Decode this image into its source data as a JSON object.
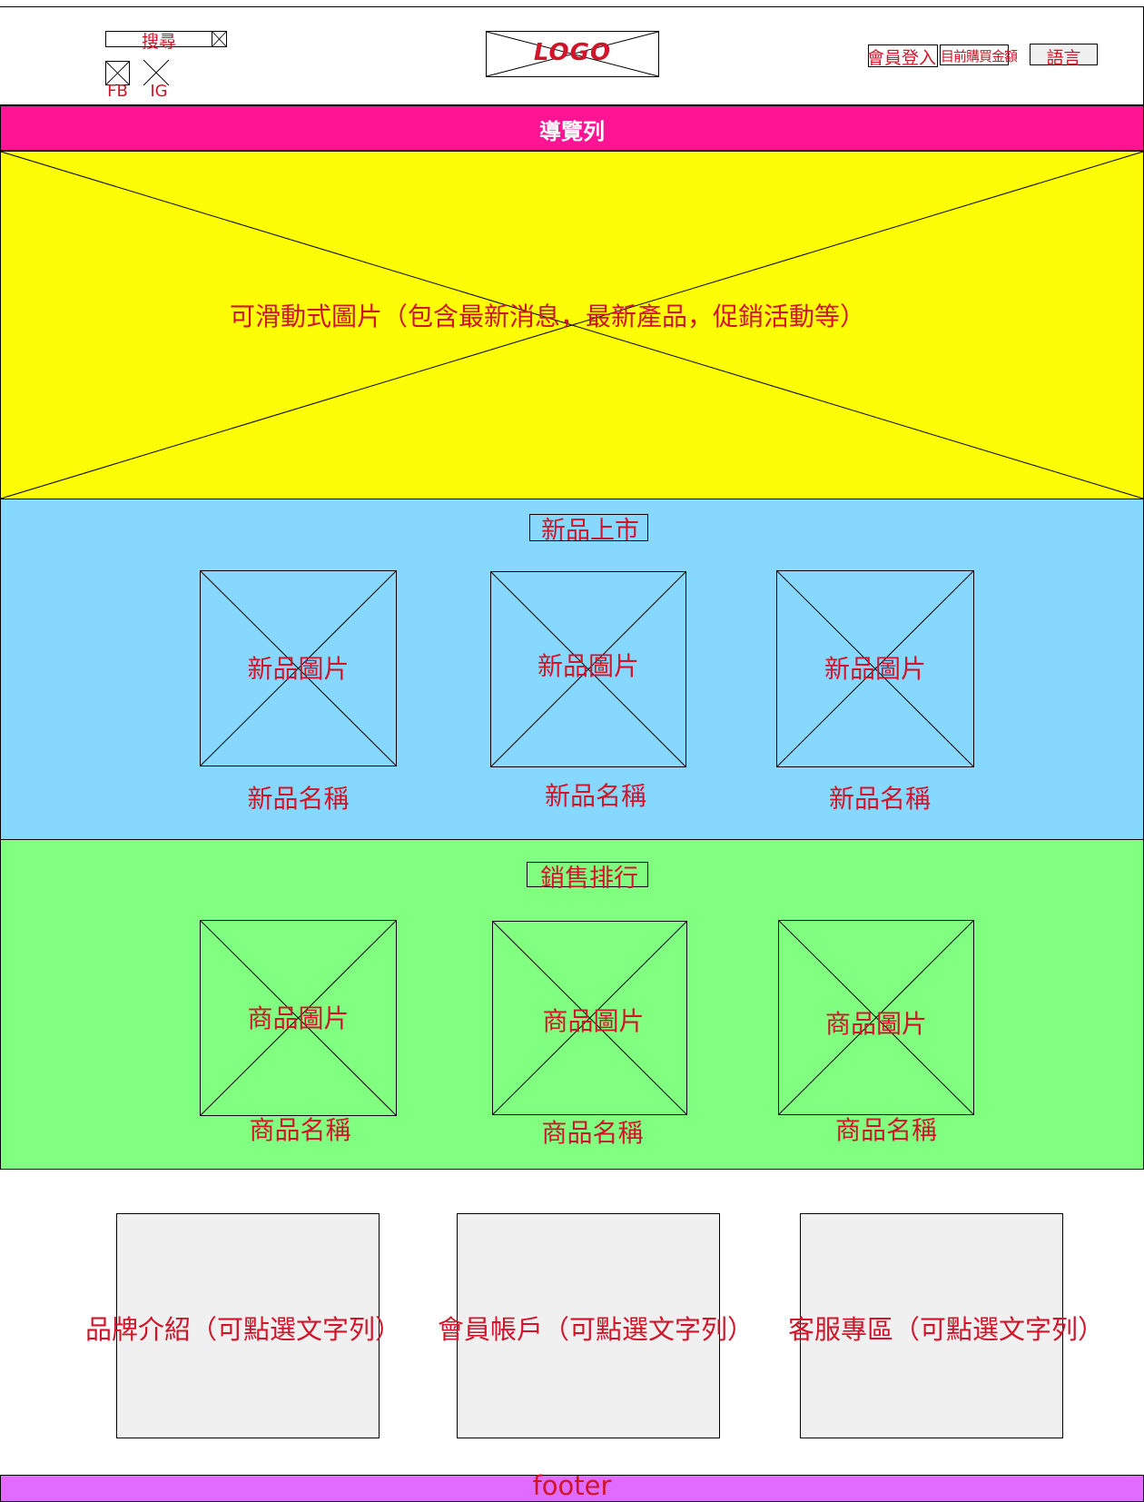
{
  "header": {
    "search_label": "搜尋",
    "fb_label": "FB",
    "ig_label": "IG",
    "logo_text": "LOGO",
    "login_label": "會員登入",
    "cart_label": "目前購買金額",
    "language_label": "語言"
  },
  "nav": {
    "label": "導覽列"
  },
  "hero": {
    "caption": "可滑動式圖片（包含最新消息，最新產品，促銷活動等）"
  },
  "new_products": {
    "title": "新品上市",
    "items": [
      {
        "image_label": "新品圖片",
        "name": "新品名稱"
      },
      {
        "image_label": "新品圖片",
        "name": "新品名稱"
      },
      {
        "image_label": "新品圖片",
        "name": "新品名稱"
      }
    ]
  },
  "best_sellers": {
    "title": "銷售排行",
    "items": [
      {
        "image_label": "商品圖片",
        "name": "商品名稱"
      },
      {
        "image_label": "商品圖片",
        "name": "商品名稱"
      },
      {
        "image_label": "商品圖片",
        "name": "商品名稱"
      }
    ]
  },
  "info_links": [
    {
      "label": "品牌介紹（可點選文字列）"
    },
    {
      "label": "會員帳戶（可點選文字列）"
    },
    {
      "label": "客服專區（可點選文字列）"
    }
  ],
  "footer": {
    "label": "footer"
  },
  "colors": {
    "nav_bg": "#ff1493",
    "hero_bg": "#fdfd07",
    "new_products_bg": "#87d8fe",
    "best_sellers_bg": "#80ff80",
    "footer_bg": "#df6cfe",
    "label_text": "#d0152a"
  }
}
